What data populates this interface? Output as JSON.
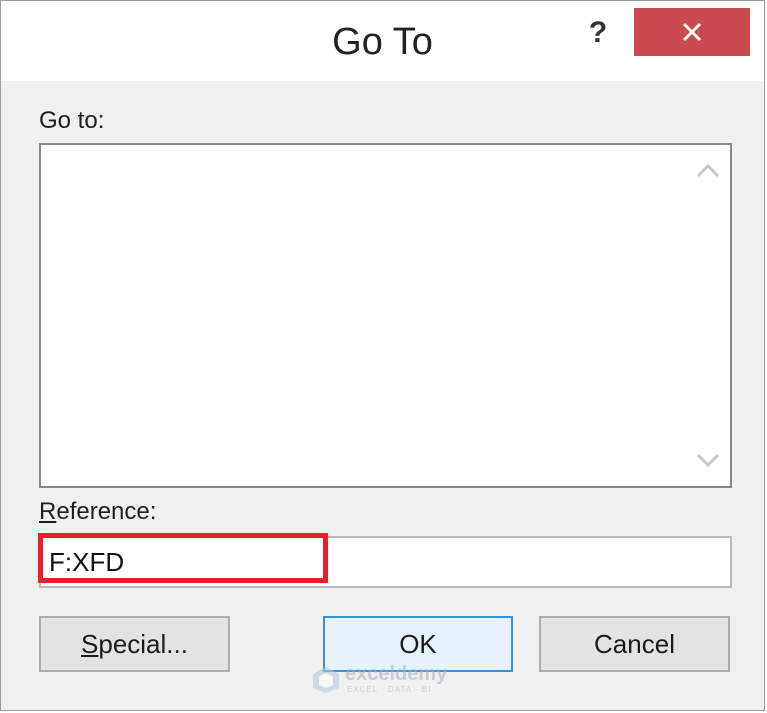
{
  "dialog": {
    "title": "Go To",
    "help_label": "?",
    "close_icon": "close-icon"
  },
  "goto": {
    "label": "Go to:",
    "items": []
  },
  "reference": {
    "label_first": "R",
    "label_rest": "eference:",
    "value": "F:XFD"
  },
  "buttons": {
    "special_first": "S",
    "special_rest": "pecial...",
    "ok": "OK",
    "cancel": "Cancel"
  },
  "watermark": {
    "name": "exceldemy",
    "tagline": "EXCEL · DATA · BI"
  },
  "colors": {
    "close_bg": "#c9494c",
    "highlight": "#e8202a",
    "ok_border": "#3c8fdc"
  }
}
